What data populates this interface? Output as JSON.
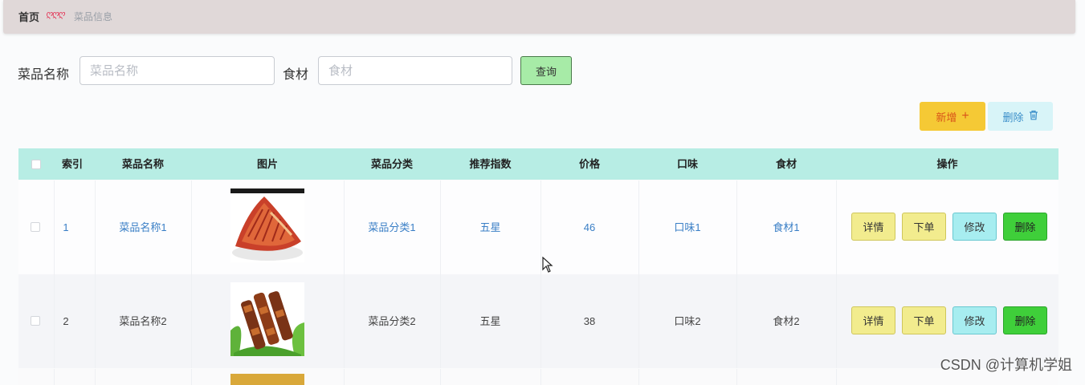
{
  "breadcrumb": {
    "home": "首页",
    "separator": "ღღღ",
    "current": "菜品信息"
  },
  "search": {
    "name_label": "菜品名称",
    "name_placeholder": "菜品名称",
    "ingredient_label": "食材",
    "ingredient_placeholder": "食材",
    "query_label": "查询"
  },
  "toolbar": {
    "add_label": "新增",
    "add_icon": "+",
    "delete_label": "删除",
    "delete_icon": "🗑"
  },
  "table": {
    "headers": {
      "index": "索引",
      "name": "菜品名称",
      "image": "图片",
      "category": "菜品分类",
      "rating": "推荐指数",
      "price": "价格",
      "flavor": "口味",
      "ingredient": "食材",
      "actions": "操作"
    },
    "rows": [
      {
        "index": "1",
        "name": "菜品名称1",
        "category": "菜品分类1",
        "rating": "五星",
        "price": "46",
        "flavor": "口味1",
        "ingredient": "食材1"
      },
      {
        "index": "2",
        "name": "菜品名称2",
        "category": "菜品分类2",
        "rating": "五星",
        "price": "38",
        "flavor": "口味2",
        "ingredient": "食材2"
      }
    ],
    "actions": {
      "detail": "详情",
      "order": "下单",
      "edit": "修改",
      "remove": "删除"
    }
  },
  "watermark": "CSDN @计算机学姐",
  "colors": {
    "header_bg": "#b7ede4",
    "link": "#3a7fc6",
    "query_btn": "#a7eba7",
    "add_btn": "#f5c935",
    "delete_btn": "#d8f4f8",
    "detail_btn": "#f2ec8e",
    "edit_btn": "#a7edf0",
    "remove_btn": "#3fcf3a"
  }
}
